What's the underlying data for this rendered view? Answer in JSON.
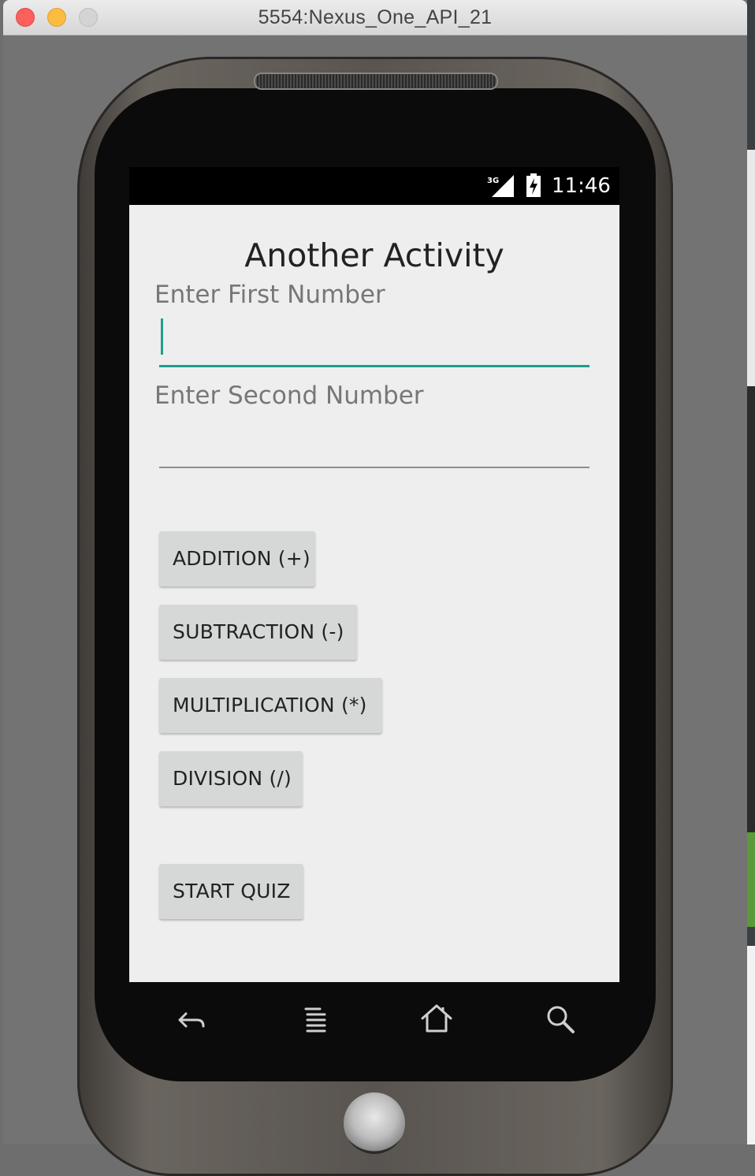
{
  "window": {
    "title": "5554:Nexus_One_API_21"
  },
  "status_bar": {
    "network": "3G",
    "time": "11:46"
  },
  "activity": {
    "title": "Another Activity",
    "first_number": {
      "label": "Enter First Number",
      "value": ""
    },
    "second_number": {
      "label": "Enter Second Number",
      "value": ""
    },
    "buttons": {
      "addition": "ADDITION (+)",
      "subtraction": "SUBTRACTION (-)",
      "multiplication": "MULTIPLICATION (*)",
      "division": "DIVISION (/)",
      "start_quiz": "START QUIZ"
    }
  },
  "hardware_keys": [
    "back-icon",
    "menu-icon",
    "home-icon",
    "search-icon"
  ],
  "colors": {
    "accent": "#1e9e8c",
    "screen_bg": "#eeeeee",
    "button_bg": "#d6d7d7"
  }
}
